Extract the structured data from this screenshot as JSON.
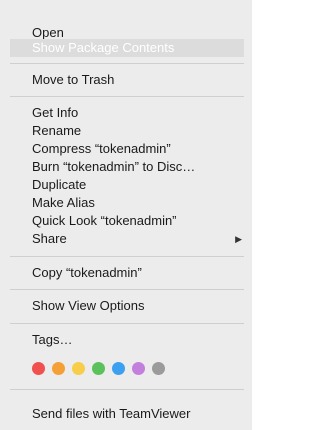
{
  "menu": {
    "items": [
      {
        "label": "Open"
      },
      {
        "label": "Show Package Contents"
      },
      {
        "label": "Move to Trash"
      },
      {
        "label": "Get Info"
      },
      {
        "label": "Rename"
      },
      {
        "label": "Compress “tokenadmin”"
      },
      {
        "label": "Burn “tokenadmin” to Disc…"
      },
      {
        "label": "Duplicate"
      },
      {
        "label": "Make Alias"
      },
      {
        "label": "Quick Look “tokenadmin”"
      },
      {
        "label": "Share",
        "submenu_icon": "chevron-right-icon"
      },
      {
        "label": "Copy “tokenadmin”"
      },
      {
        "label": "Show View Options"
      },
      {
        "label": "Tags…"
      },
      {
        "label": "Send files with TeamViewer"
      }
    ],
    "highlighted_item": "Show Package Contents",
    "share_arrow": "▶"
  },
  "tags": [
    {
      "name": "red-tag",
      "color": "#f0504e"
    },
    {
      "name": "orange-tag",
      "color": "#f5a036"
    },
    {
      "name": "yellow-tag",
      "color": "#f7cd4a"
    },
    {
      "name": "green-tag",
      "color": "#5bc15b"
    },
    {
      "name": "blue-tag",
      "color": "#3ca0f0"
    },
    {
      "name": "purple-tag",
      "color": "#c37fdc"
    },
    {
      "name": "gray-tag",
      "color": "#9b9b9b"
    }
  ],
  "colors": {
    "menu_background": "#ececec",
    "highlight": "#dcdcdc",
    "separator": "#cfcfcf"
  }
}
